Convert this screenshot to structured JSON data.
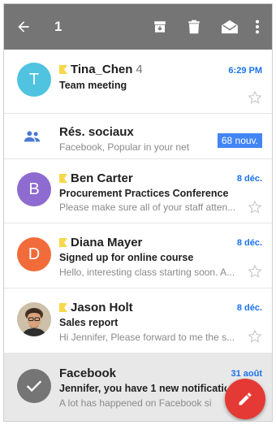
{
  "appbar": {
    "selected_count": "1",
    "icons": [
      "back-arrow-icon",
      "archive-icon",
      "delete-icon",
      "mark-read-icon",
      "more-vert-icon"
    ],
    "background": "#757575"
  },
  "emails": [
    {
      "avatar_letter": "T",
      "avatar_color": "#4fc3e0",
      "sender": "Tina_Chen",
      "count": "4",
      "important": true,
      "date": "6:29 PM",
      "subject": "Team meeting",
      "snippet": ""
    },
    {
      "category": "Rés. sociaux",
      "snippet": "Facebook, Popular in your net",
      "badge": "68 nouv."
    },
    {
      "avatar_letter": "B",
      "avatar_color": "#8e6bd0",
      "sender": "Ben Carter",
      "important": true,
      "date": "8 déc.",
      "subject": "Procurement Practices Conference",
      "snippet": "Please make sure all of your staff atten..."
    },
    {
      "avatar_letter": "D",
      "avatar_color": "#f26b3a",
      "sender": "Diana Mayer",
      "important": true,
      "date": "8 déc.",
      "subject": "Signed up for online course",
      "snippet": "Hello, interesting class starting soon. A..."
    },
    {
      "avatar_photo": true,
      "sender": "Jason Holt",
      "important": true,
      "date": "8 déc.",
      "subject": "Sales report",
      "snippet": "Hi Jennifer, Please forward to me the s..."
    },
    {
      "selected": true,
      "sender": "Facebook",
      "date": "31 août",
      "subject": "Jennifer, you have 1 new notification",
      "snippet": "A lot has happened on Facebook si"
    }
  ],
  "colors": {
    "accent": "#1a73e8",
    "fab": "#e53935",
    "badge": "#4285f4",
    "important": "#f7d84a"
  }
}
